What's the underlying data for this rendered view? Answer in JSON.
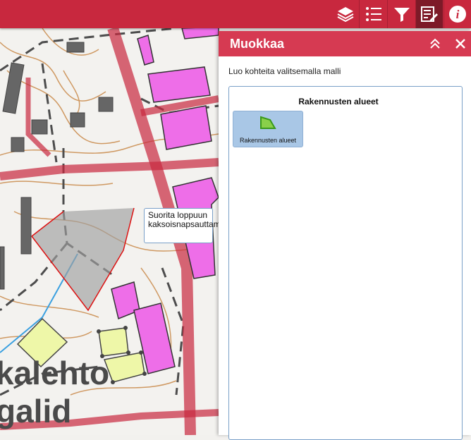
{
  "toolbar": {
    "buttons": [
      {
        "icon": "layers-icon"
      },
      {
        "icon": "list-icon"
      },
      {
        "icon": "filter-icon"
      },
      {
        "icon": "edit-icon",
        "active": true
      },
      {
        "icon": "info-icon"
      }
    ],
    "color": "#c8283e"
  },
  "panel": {
    "title": "Muokkaa",
    "description": "Luo kohteita valitsemalla malli",
    "group_title": "Rakennusten alueet",
    "template_label": "Rakennusten alueet",
    "header_color": "#d63a52"
  },
  "map": {
    "tooltip": "Suorita loppuun kaksoisnapsauttamalla",
    "place_label_1": "kalehto",
    "place_label_2": "galid"
  }
}
